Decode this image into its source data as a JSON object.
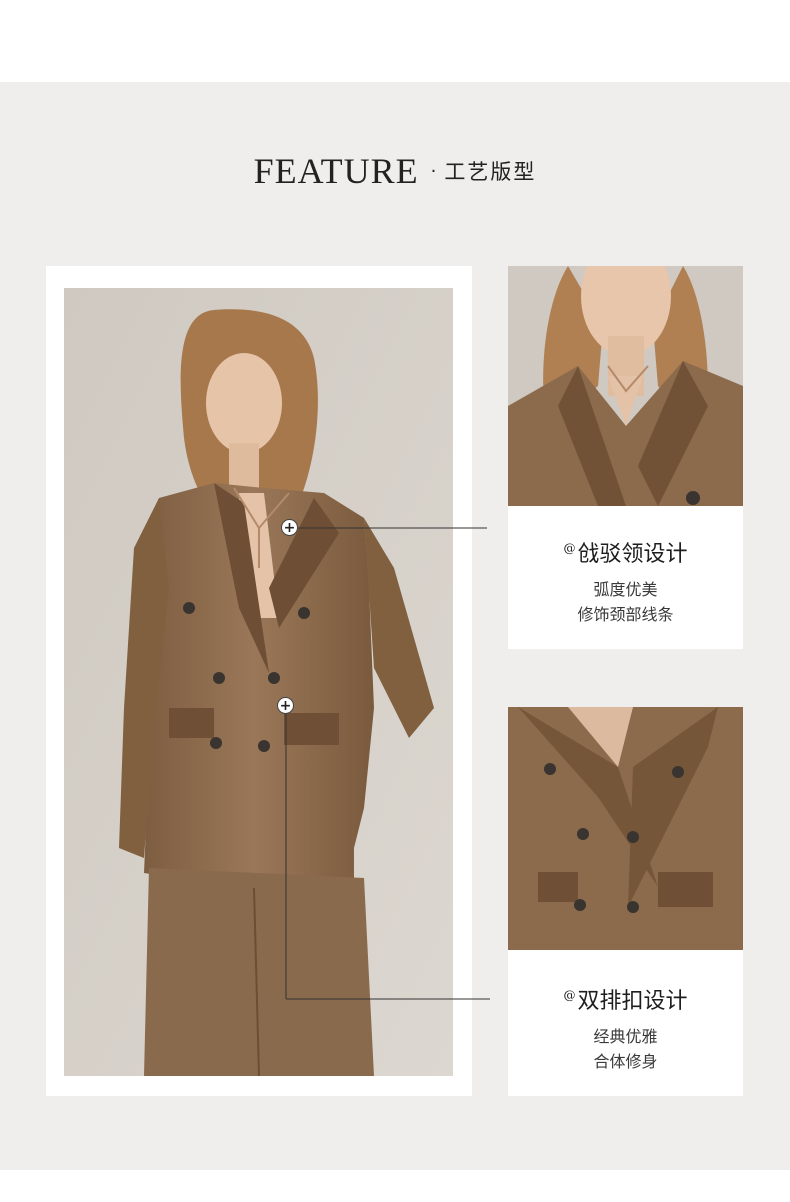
{
  "header": {
    "title_en": "FEATURE",
    "separator": "·",
    "title_zh": "工艺版型"
  },
  "main_photo": {
    "subject": "woman in brown double-breasted suit"
  },
  "features": [
    {
      "at": "@",
      "title": "戗驳领设计",
      "lines": [
        "弧度优美",
        "修饰颈部线条"
      ]
    },
    {
      "at": "@",
      "title": "双排扣设计",
      "lines": [
        "经典优雅",
        "合体修身"
      ]
    }
  ],
  "colors": {
    "band": "#efeeec",
    "suit": "#8a6a4c",
    "backdrop": "#d6d0c8"
  }
}
